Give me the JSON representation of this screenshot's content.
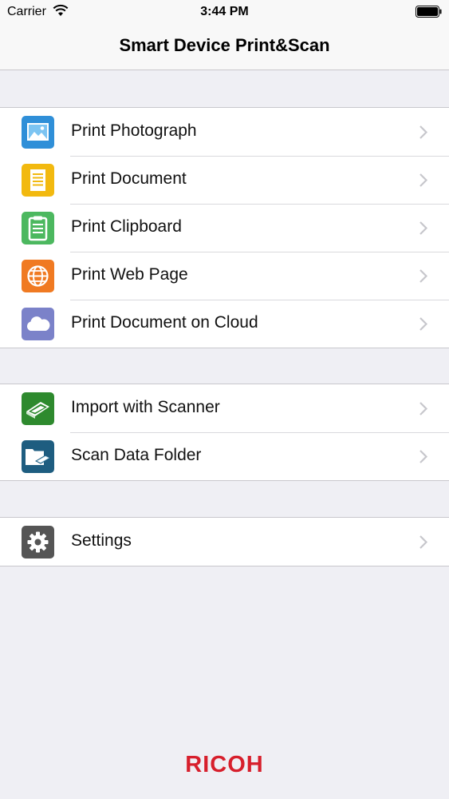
{
  "status_bar": {
    "carrier": "Carrier",
    "time": "3:44 PM"
  },
  "nav": {
    "title": "Smart Device Print&Scan"
  },
  "print_group": [
    {
      "label": "Print Photograph",
      "icon": "photo-icon",
      "color": "#2f8fd8"
    },
    {
      "label": "Print Document",
      "icon": "document-icon",
      "color": "#f2b90f"
    },
    {
      "label": "Print Clipboard",
      "icon": "clipboard-icon",
      "color": "#4cb85f"
    },
    {
      "label": "Print Web Page",
      "icon": "globe-icon",
      "color": "#f07a22"
    },
    {
      "label": "Print Document on Cloud",
      "icon": "cloud-icon",
      "color": "#7b82c9"
    }
  ],
  "scan_group": [
    {
      "label": "Import with Scanner",
      "icon": "scanner-icon",
      "color": "#2e8a2e"
    },
    {
      "label": "Scan Data Folder",
      "icon": "scan-folder-icon",
      "color": "#1e5d80"
    }
  ],
  "settings_group": [
    {
      "label": "Settings",
      "icon": "gear-icon",
      "color": "#555555"
    }
  ],
  "brand": {
    "logo": "RICOH",
    "color": "#d71f2c"
  }
}
